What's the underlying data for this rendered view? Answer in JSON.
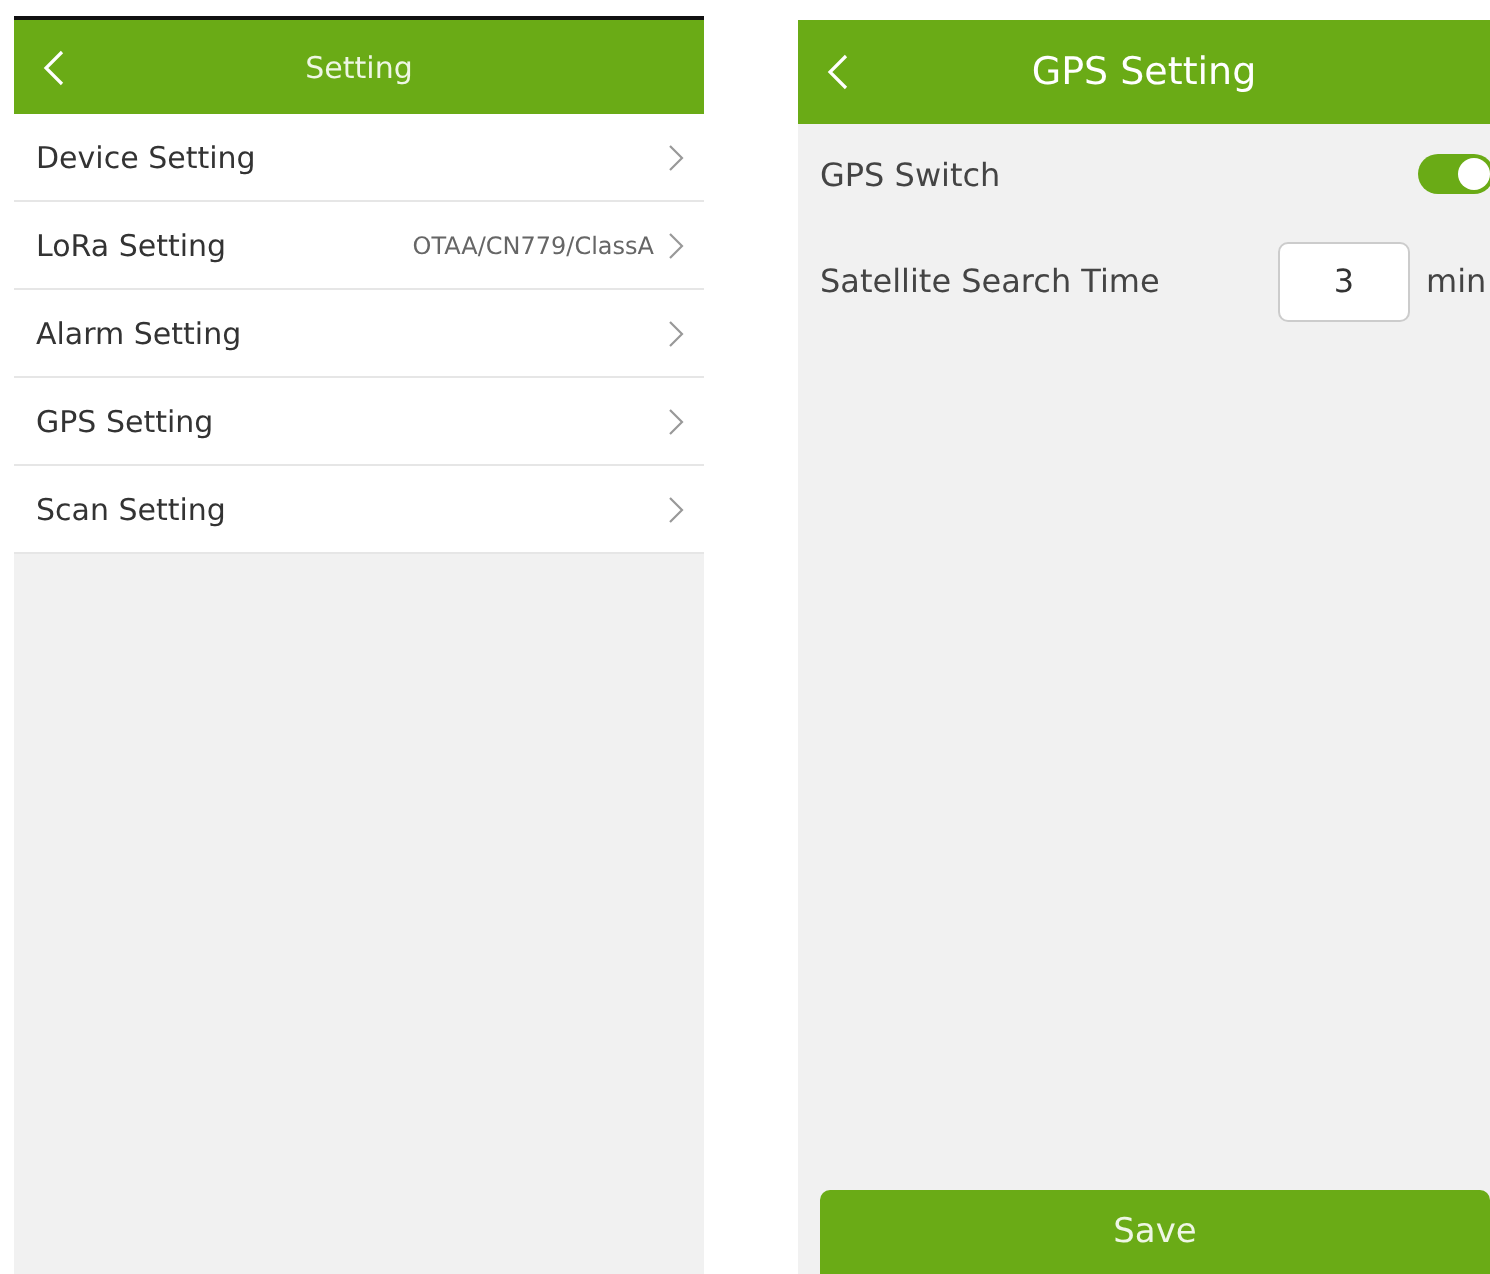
{
  "settings_screen": {
    "title": "Setting",
    "items": [
      {
        "label": "Device Setting"
      },
      {
        "label": "LoRa Setting",
        "value": "OTAA/CN779/ClassA"
      },
      {
        "label": "Alarm Setting"
      },
      {
        "label": "GPS Setting"
      },
      {
        "label": "Scan Setting"
      }
    ]
  },
  "gps_screen": {
    "title": "GPS Setting",
    "gps_switch": {
      "label": "GPS Switch",
      "on": true
    },
    "search_time": {
      "label": "Satellite Search Time",
      "value": "3",
      "unit": "min"
    },
    "save_button": "Save"
  }
}
